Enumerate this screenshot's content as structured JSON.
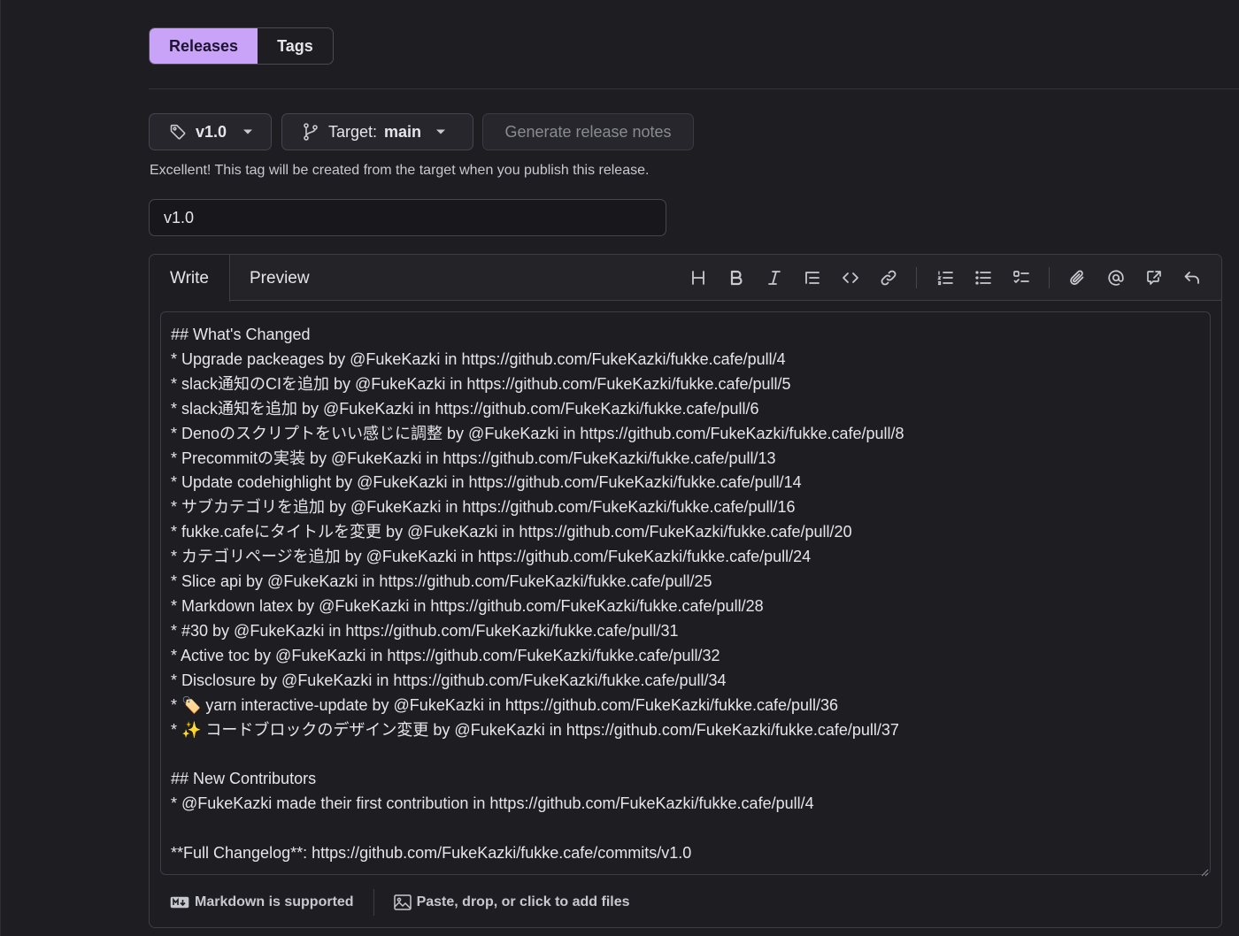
{
  "segmented": {
    "releases_label": "Releases",
    "tags_label": "Tags"
  },
  "tag_button": {
    "label": "v1.0"
  },
  "target_button": {
    "prefix": "Target:",
    "branch": "main"
  },
  "generate_button": {
    "label": "Generate release notes"
  },
  "hint": "Excellent! This tag will be created from the target when you publish this release.",
  "title_input": {
    "value": "v1.0"
  },
  "editor": {
    "tabs": {
      "write": "Write",
      "preview": "Preview"
    },
    "body": "## What's Changed\n* Upgrade packeages by @FukeKazki in https://github.com/FukeKazki/fukke.cafe/pull/4\n* slack通知のCIを追加 by @FukeKazki in https://github.com/FukeKazki/fukke.cafe/pull/5\n* slack通知を追加 by @FukeKazki in https://github.com/FukeKazki/fukke.cafe/pull/6\n* Denoのスクリプトをいい感じに調整 by @FukeKazki in https://github.com/FukeKazki/fukke.cafe/pull/8\n* Precommitの実装 by @FukeKazki in https://github.com/FukeKazki/fukke.cafe/pull/13\n* Update codehighlight by @FukeKazki in https://github.com/FukeKazki/fukke.cafe/pull/14\n* サブカテゴリを追加 by @FukeKazki in https://github.com/FukeKazki/fukke.cafe/pull/16\n* fukke.cafeにタイトルを変更 by @FukeKazki in https://github.com/FukeKazki/fukke.cafe/pull/20\n* カテゴリページを追加 by @FukeKazki in https://github.com/FukeKazki/fukke.cafe/pull/24\n* Slice api by @FukeKazki in https://github.com/FukeKazki/fukke.cafe/pull/25\n* Markdown latex by @FukeKazki in https://github.com/FukeKazki/fukke.cafe/pull/28\n* #30 by @FukeKazki in https://github.com/FukeKazki/fukke.cafe/pull/31\n* Active toc by @FukeKazki in https://github.com/FukeKazki/fukke.cafe/pull/32\n* Disclosure by @FukeKazki in https://github.com/FukeKazki/fukke.cafe/pull/34\n* 🏷️ yarn interactive-update by @FukeKazki in https://github.com/FukeKazki/fukke.cafe/pull/36\n* ✨ コードブロックのデザイン変更 by @FukeKazki in https://github.com/FukeKazki/fukke.cafe/pull/37\n\n## New Contributors\n* @FukeKazki made their first contribution in https://github.com/FukeKazki/fukke.cafe/pull/4\n\n**Full Changelog**: https://github.com/FukeKazki/fukke.cafe/commits/v1.0",
    "footer": {
      "markdown_label": "Markdown is supported",
      "attach_label": "Paste, drop, or click to add files"
    },
    "toolbar_icons": [
      "heading-icon",
      "bold-icon",
      "italic-icon",
      "quote-icon",
      "code-icon",
      "link-icon",
      "ordered-list-icon",
      "unordered-list-icon",
      "task-list-icon",
      "attach-icon",
      "mention-icon",
      "cross-reference-icon",
      "reply-icon"
    ]
  },
  "colors": {
    "background": "#1d1d22",
    "accent": "#c9a3f7",
    "border": "#45454d",
    "text": "#e6e6ea",
    "muted": "#8a8a93"
  }
}
